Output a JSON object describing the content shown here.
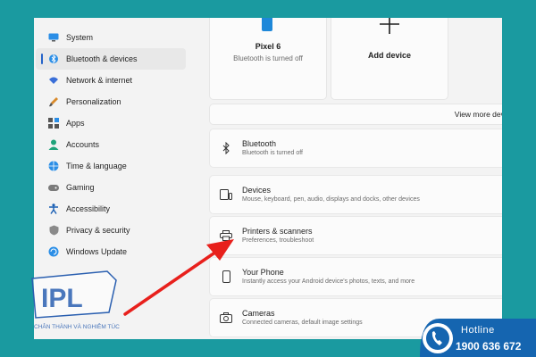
{
  "sidebar": {
    "items": [
      {
        "label": "System",
        "icon": "monitor-icon"
      },
      {
        "label": "Bluetooth & devices",
        "icon": "bluetooth-icon",
        "active": true
      },
      {
        "label": "Network & internet",
        "icon": "wifi-icon"
      },
      {
        "label": "Personalization",
        "icon": "brush-icon"
      },
      {
        "label": "Apps",
        "icon": "apps-icon"
      },
      {
        "label": "Accounts",
        "icon": "person-icon"
      },
      {
        "label": "Time & language",
        "icon": "globe-icon"
      },
      {
        "label": "Gaming",
        "icon": "gamepad-icon"
      },
      {
        "label": "Accessibility",
        "icon": "accessibility-icon"
      },
      {
        "label": "Privacy & security",
        "icon": "shield-icon"
      },
      {
        "label": "Windows Update",
        "icon": "update-icon"
      }
    ]
  },
  "devices": {
    "phone": {
      "title": "Pixel 6",
      "status": "Bluetooth is turned off"
    },
    "add": {
      "title": "Add device"
    },
    "view_more": "View more devic"
  },
  "rows": [
    {
      "title": "Bluetooth",
      "sub": "Bluetooth is turned off",
      "icon": "bluetooth-icon"
    },
    {
      "title": "Devices",
      "sub": "Mouse, keyboard, pen, audio, displays and docks, other devices",
      "icon": "devices-icon"
    },
    {
      "title": "Printers & scanners",
      "sub": "Preferences, troubleshoot",
      "icon": "printer-icon"
    },
    {
      "title": "Your Phone",
      "sub": "Instantly access your Android device's photos, texts, and more",
      "icon": "phone-icon"
    },
    {
      "title": "Cameras",
      "sub": "Connected cameras, default image settings",
      "icon": "camera-icon"
    }
  ],
  "watermark": {
    "logo": "IPL",
    "slogan": "CHÂN THÀNH VÀ NGHIÊM TÚC"
  },
  "hotline": {
    "label": "Hotline",
    "number": "1900 636 672"
  },
  "colors": {
    "background": "#1a9aa0",
    "accent": "#2563c9",
    "arrow": "#e8201c",
    "hotline": "#1565b0"
  }
}
